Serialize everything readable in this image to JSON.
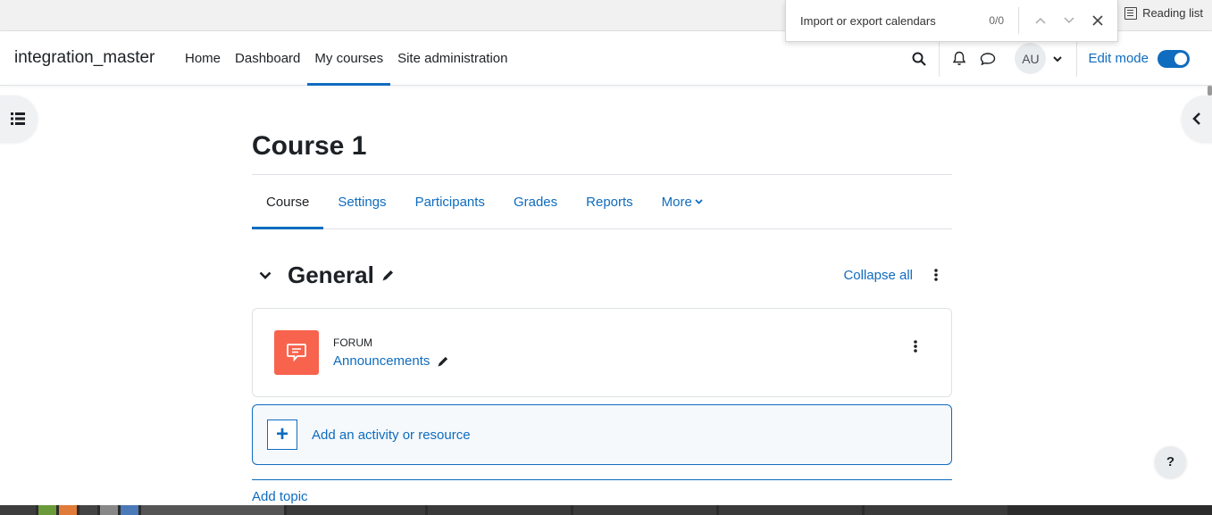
{
  "browser": {
    "reading_list_label": "Reading list",
    "find_bar": {
      "query": "Import or export calendars",
      "count": "0/0"
    }
  },
  "navbar": {
    "brand": "integration_master",
    "items": [
      {
        "label": "Home"
      },
      {
        "label": "Dashboard"
      },
      {
        "label": "My courses",
        "active": true
      },
      {
        "label": "Site administration"
      }
    ],
    "user_initials": "AU",
    "edit_mode_label": "Edit mode",
    "edit_mode_on": true
  },
  "course": {
    "title": "Course 1",
    "tabs": [
      {
        "label": "Course",
        "active": true
      },
      {
        "label": "Settings"
      },
      {
        "label": "Participants"
      },
      {
        "label": "Grades"
      },
      {
        "label": "Reports"
      },
      {
        "label": "More"
      }
    ],
    "section": {
      "title": "General",
      "collapse_all_label": "Collapse all"
    },
    "activity": {
      "type": "FORUM",
      "name": "Announcements"
    },
    "add_activity_label": "Add an activity or resource",
    "add_topic_label": "Add topic"
  },
  "help_label": "?",
  "colors": {
    "accent": "#0f6cbf",
    "forum_icon": "#f7634d"
  }
}
